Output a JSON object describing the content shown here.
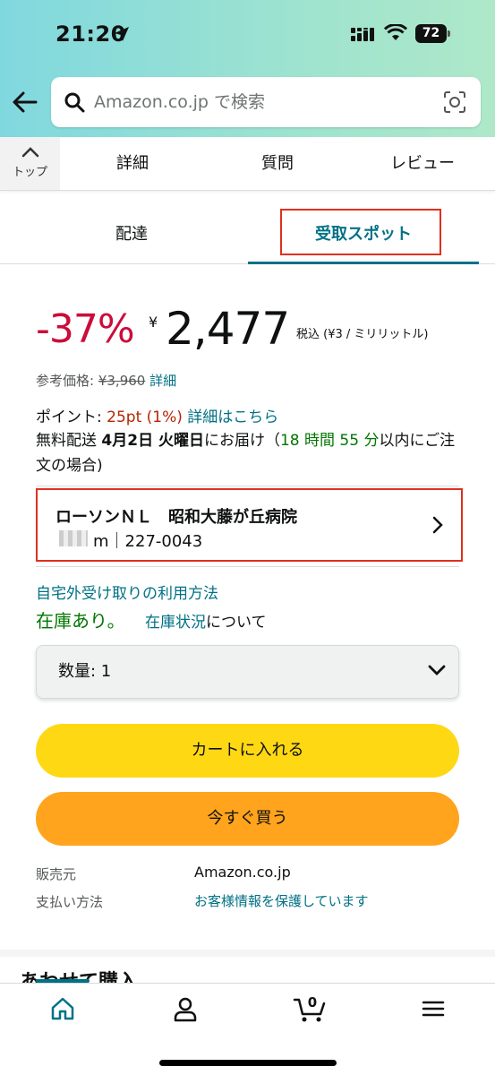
{
  "status_bar": {
    "time": "21:20",
    "battery": "72"
  },
  "search": {
    "placeholder": "Amazon.co.jp で検索"
  },
  "nav_tabs": {
    "top_label": "トップ",
    "items": [
      "詳細",
      "質問",
      "レビュー"
    ]
  },
  "delivery_tabs": {
    "items": [
      "配達",
      "受取スポット"
    ],
    "selected": "受取スポット"
  },
  "price": {
    "discount": "-37%",
    "currency_symbol": "¥",
    "amount": "2,477",
    "tax_note": "税込 (¥3 / ミリリットル)",
    "ref_label": "参考価格:",
    "ref_value": "¥3,960",
    "ref_link": "詳細"
  },
  "points": {
    "label": "ポイント:",
    "value": "25pt",
    "percent": "(1%)",
    "link": "詳細はこちら"
  },
  "shipping": {
    "prefix": "無料配送",
    "date": "4月2日 火曜日",
    "mid": "にお届け（",
    "countdown": "18 時間 55 分",
    "suffix": "以内にご注文の場合)"
  },
  "pickup_store": {
    "name": "ローソンＮＬ　昭和大藤が丘病院",
    "address": "m｜227-0043"
  },
  "pickup_howto": "自宅外受け取りの利用方法",
  "stock": {
    "status": "在庫あり。",
    "link": "在庫状況",
    "suffix": "について"
  },
  "quantity": {
    "label": "数量: 1"
  },
  "buttons": {
    "add_to_cart": "カートに入れる",
    "buy_now": "今すぐ買う"
  },
  "info": {
    "seller_label": "販売元",
    "seller_value": "Amazon.co.jp",
    "payment_label": "支払い方法",
    "payment_value": "お客様情報を保護しています"
  },
  "partial_heading": "あわせて購入",
  "bottom_nav": {
    "cart_count": "0",
    "items": [
      "home-icon",
      "account-icon",
      "cart-icon",
      "menu-icon"
    ]
  },
  "colors": {
    "discount": "#cc0c39",
    "link": "#007185",
    "in_stock": "#007600",
    "cart_button": "#ffd814",
    "buy_button": "#ffa41c",
    "highlight_box": "#e0301e"
  }
}
